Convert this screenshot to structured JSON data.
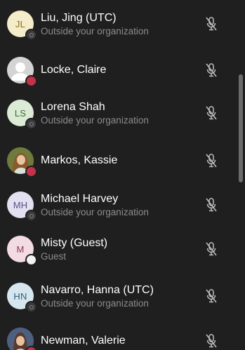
{
  "participants": [
    {
      "name": "Liu, Jing (UTC)",
      "subtitle": "Outside your organization",
      "avatar": {
        "type": "initials",
        "initials": "JL",
        "bg": "#f5ecc9",
        "fg": "#8a6d1d"
      },
      "status": "offline",
      "mic_icon": "mic-off-icon"
    },
    {
      "name": "Locke, Claire",
      "subtitle": "",
      "avatar": {
        "type": "photo",
        "label": "default-person"
      },
      "status": "busy",
      "mic_icon": "mic-off-icon"
    },
    {
      "name": "Lorena Shah",
      "subtitle": "Outside your organization",
      "avatar": {
        "type": "initials",
        "initials": "LS",
        "bg": "#dcebd6",
        "fg": "#3f6b35"
      },
      "status": "offline",
      "mic_icon": "mic-off-icon"
    },
    {
      "name": "Markos, Kassie",
      "subtitle": "",
      "avatar": {
        "type": "photo",
        "label": "person-photo"
      },
      "status": "busy",
      "mic_icon": "mic-off-icon"
    },
    {
      "name": "Michael Harvey",
      "subtitle": "Outside your organization",
      "avatar": {
        "type": "initials",
        "initials": "MH",
        "bg": "#e3e0f0",
        "fg": "#5a4f8a"
      },
      "status": "offline",
      "mic_icon": "mic-off-icon"
    },
    {
      "name": "Misty (Guest)",
      "subtitle": "Guest",
      "avatar": {
        "type": "initials",
        "initials": "M",
        "bg": "#f3dbe3",
        "fg": "#8a3a55"
      },
      "status": "available-white",
      "mic_icon": "mic-off-icon"
    },
    {
      "name": "Navarro, Hanna (UTC)",
      "subtitle": "Outside your organization",
      "avatar": {
        "type": "initials",
        "initials": "HN",
        "bg": "#d6e6ef",
        "fg": "#2f5f7a"
      },
      "status": "offline",
      "mic_icon": "mic-off-icon"
    },
    {
      "name": "Newman, Valerie",
      "subtitle": "",
      "avatar": {
        "type": "photo",
        "label": "person-photo"
      },
      "status": "busy",
      "mic_icon": "mic-off-icon"
    }
  ],
  "colors": {
    "background": "#1f1f1f",
    "name_text": "#ffffff",
    "subtitle_text": "#8c8c8c",
    "busy": "#c4314b",
    "mic_icon": "#bdbdbd",
    "scrollbar": "#6b6b6b"
  }
}
